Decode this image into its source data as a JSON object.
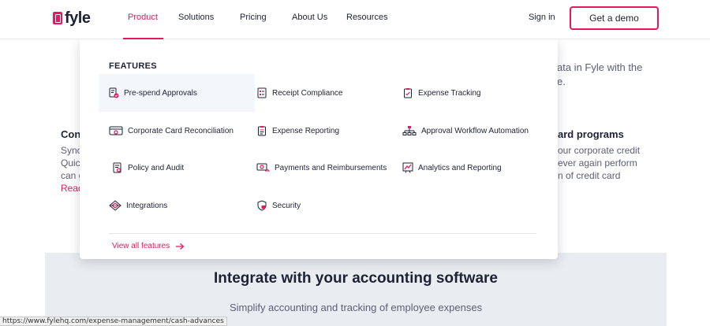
{
  "brand": {
    "logo_text": "fyle",
    "accent": "#e5195e",
    "text_dark": "#1e2235"
  },
  "nav": {
    "items": [
      "Product",
      "Solutions",
      "Pricing",
      "About Us",
      "Resources"
    ],
    "active": "Product",
    "sign_in": "Sign in",
    "demo_button": "Get a demo"
  },
  "background": {
    "right_snippet_1": "ata in Fyle with the",
    "right_snippet_2": "e.",
    "left_head": "Con",
    "left_lines": [
      "Sync",
      "Quic",
      "can g"
    ],
    "left_link": "Read",
    "right_head": "ard programs",
    "right_lines": [
      "our corporate credit",
      "ever again perform",
      "n of credit card"
    ],
    "band_title": "Integrate with your accounting software",
    "band_subtitle": "Simplify accounting and tracking of employee expenses"
  },
  "dropdown": {
    "heading": "FEATURES",
    "features": [
      {
        "label": "Pre-spend Approvals",
        "icon": "approval-doc-icon"
      },
      {
        "label": "Receipt Compliance",
        "icon": "receipt-icon"
      },
      {
        "label": "Expense Tracking",
        "icon": "clipboard-icon"
      },
      {
        "label": "Corporate Card Reconciliation",
        "icon": "credit-card-icon"
      },
      {
        "label": "Expense Reporting",
        "icon": "report-icon"
      },
      {
        "label": "Approval Workflow Automation",
        "icon": "workflow-icon"
      },
      {
        "label": "Policy and Audit",
        "icon": "policy-doc-icon"
      },
      {
        "label": "Payments and Reimbursements",
        "icon": "payment-icon"
      },
      {
        "label": "Analytics and Reporting",
        "icon": "analytics-icon"
      },
      {
        "label": "Integrations",
        "icon": "integrations-icon"
      },
      {
        "label": "Security",
        "icon": "shield-icon"
      }
    ],
    "view_all": "View all features"
  },
  "status_url": "https://www.fylehq.com/expense-management/cash-advances"
}
